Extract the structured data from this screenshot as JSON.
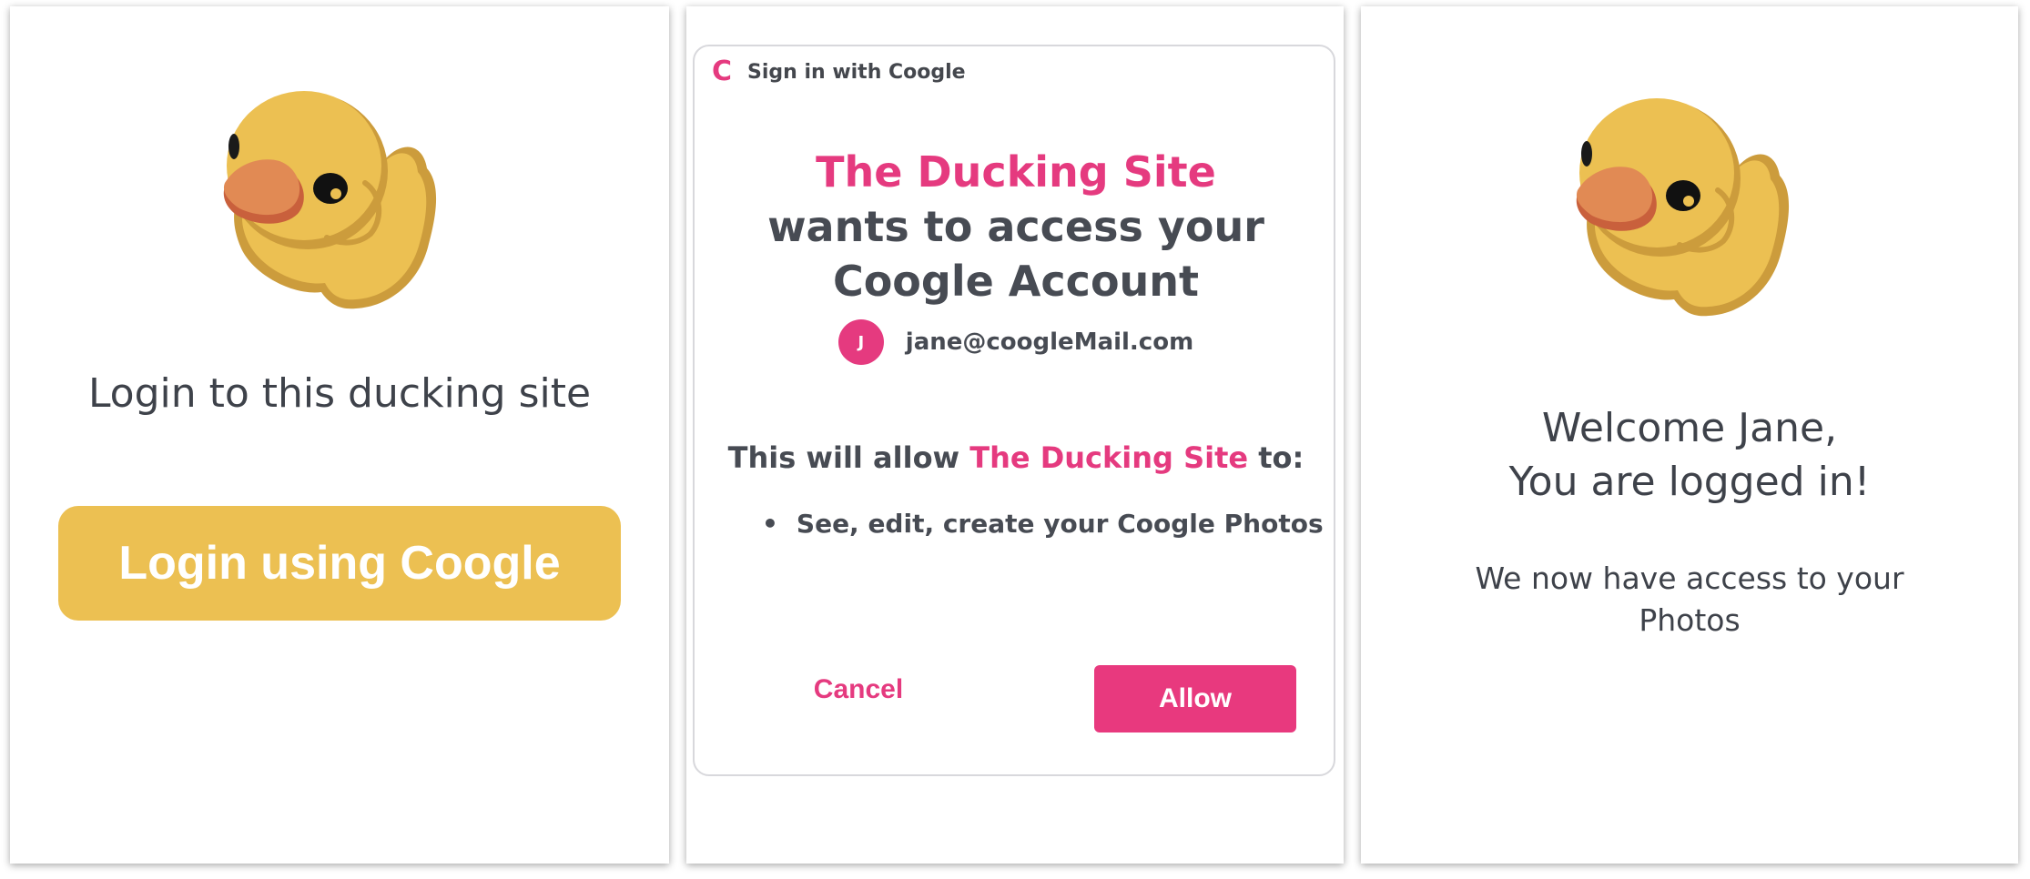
{
  "screens": {
    "login": {
      "title": "Login to this ducking site",
      "button_label": "Login using Coogle"
    },
    "consent": {
      "header_logo": "C",
      "header_title": "Sign in with Coogle",
      "site_name": "The Ducking Site",
      "request_text": "wants to access your Coogle Account",
      "account": {
        "avatar_initial": "J",
        "email": "jane@coogleMail.com"
      },
      "allow_prefix": "This will allow",
      "allow_site": "The Ducking Site",
      "allow_suffix": "to:",
      "permissions": [
        "See, edit, create your Coogle Photos"
      ],
      "cancel_label": "Cancel",
      "allow_label": "Allow"
    },
    "welcome": {
      "line1": "Welcome Jane,",
      "line2": "You are logged in!",
      "access_line1": "We now have access to your",
      "access_line2": "Photos"
    }
  },
  "icons": {
    "duck": "rubber-duck-icon",
    "logo": "coogle-logo-icon",
    "bullet": "bullet-icon"
  },
  "colors": {
    "brand_pink": "#e53a7f",
    "duck_yellow": "#ecc052",
    "text_dark": "#474b53"
  }
}
